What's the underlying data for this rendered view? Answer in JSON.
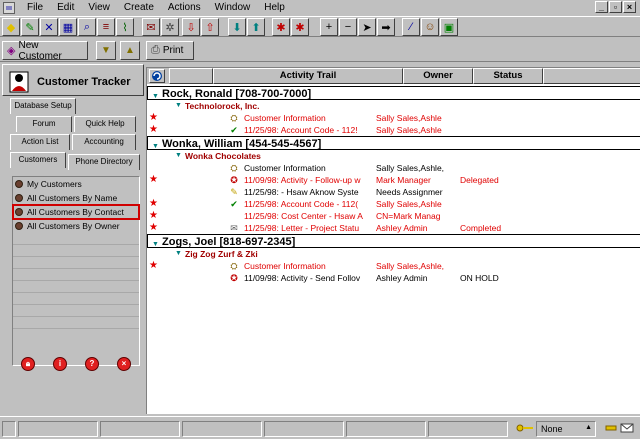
{
  "menu": [
    "File",
    "Edit",
    "View",
    "Create",
    "Actions",
    "Window",
    "Help"
  ],
  "toolbar2": {
    "new_customer": "New Customer",
    "print": "Print"
  },
  "left_panel": {
    "title": "Customer Tracker",
    "tabs_row1": [
      "Database Setup"
    ],
    "tabs_row2": [
      "Forum",
      "Quick Help"
    ],
    "tabs_row3": [
      "Action List",
      "Accounting"
    ],
    "tabs_row4": [
      "Customers",
      "Phone Directory"
    ],
    "items": [
      "My Customers",
      "All Customers By Name",
      "All Customers By Contact",
      "All Customers By Owner"
    ],
    "selected": "All Customers By Contact"
  },
  "grid": {
    "headers": {
      "activity": "Activity Trail",
      "owner": "Owner",
      "status": "Status"
    },
    "groups": [
      {
        "contact": "Rock, Ronald [708-700-7000]",
        "company": "Technolorock, Inc.",
        "rows": [
          {
            "star": true,
            "icon": "customer-info",
            "activity": "Customer Information",
            "owner": "Sally Sales,Ashle",
            "status": "",
            "red": true
          },
          {
            "star": true,
            "icon": "check",
            "activity": "11/25/98: Account Code - 112!",
            "owner": "Sally Sales,Ashle",
            "status": "",
            "red": true
          }
        ]
      },
      {
        "contact": "Wonka, William [454-545-4567]",
        "company": "Wonka Chocolates",
        "rows": [
          {
            "star": false,
            "icon": "customer-info",
            "activity": "Customer Information",
            "owner": "Sally Sales,Ashle,",
            "status": "",
            "red": false
          },
          {
            "star": true,
            "icon": "followup",
            "activity": "11/09/98: Activity - Follow-up w",
            "owner": "Mark Manager",
            "status": "Delegated",
            "red": true
          },
          {
            "star": false,
            "icon": "note",
            "activity": "11/25/98: - Hsaw Aknow Syste",
            "owner": "Needs Assignmer",
            "status": "",
            "red": false
          },
          {
            "star": true,
            "icon": "check",
            "activity": "11/25/98: Account Code - 112(",
            "owner": "Sally Sales,Ashle",
            "status": "",
            "red": true
          },
          {
            "star": true,
            "icon": "none",
            "activity": "11/25/98: Cost Center - Hsaw A",
            "owner": "CN=Mark Manag",
            "status": "",
            "red": true
          },
          {
            "star": true,
            "icon": "letter",
            "activity": "11/25/98: Letter - Project Statu",
            "owner": "Ashley Admin",
            "status": "Completed",
            "red": true
          }
        ]
      },
      {
        "contact": "Zogs, Joel [818-697-2345]",
        "company": "Zig Zog Zurf & Zki",
        "rows": [
          {
            "star": true,
            "icon": "customer-info",
            "activity": "Customer Information",
            "owner": "Sally Sales,Ashle,",
            "status": "",
            "red": true
          },
          {
            "star": false,
            "icon": "followup",
            "activity": "11/09/98: Activity - Send Follov",
            "owner": "Ashley Admin",
            "status": "ON HOLD",
            "red": false
          }
        ]
      }
    ]
  },
  "statusbar": {
    "location": "None"
  },
  "colors": {
    "accent_red": "#e00000",
    "caret_teal": "#008080",
    "company_red": "#a00000"
  }
}
